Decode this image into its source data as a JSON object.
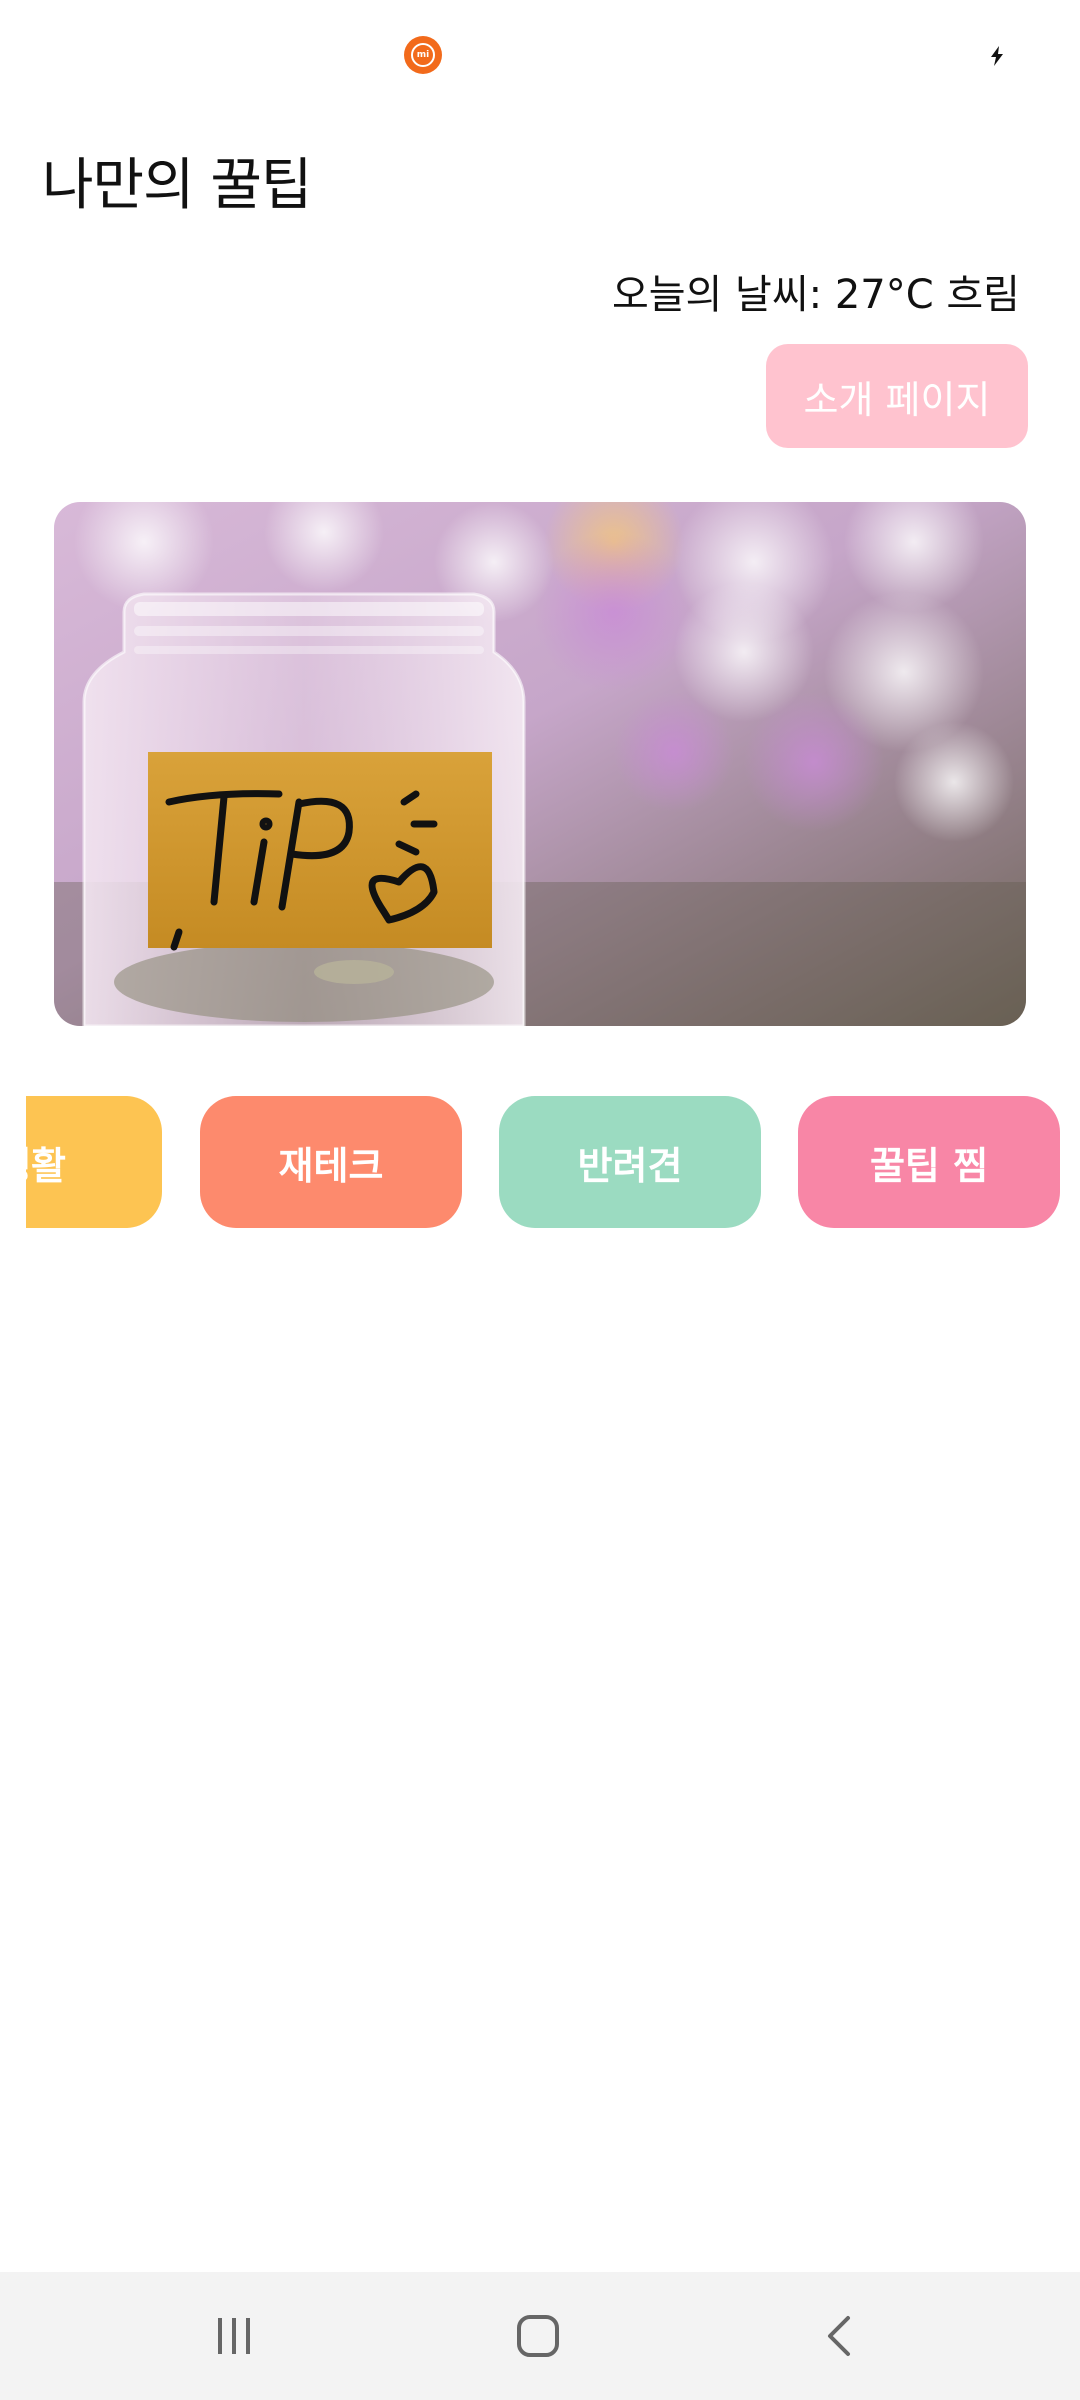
{
  "app": {
    "title": "나만의 꿀팁"
  },
  "status_bar": {
    "app_icon": "mi-app-icon",
    "app_icon_text": "mi",
    "right_icon": "charging-bolt-icon"
  },
  "weather": {
    "text": "오늘의 날씨: 27°C 흐림"
  },
  "intro_button": {
    "label": "소개 페이지",
    "color": "#ffc3cf"
  },
  "hero": {
    "label_text": "TiP",
    "icon": "tip-jar-image"
  },
  "categories": [
    {
      "label": "생활",
      "color": "#fdc452"
    },
    {
      "label": "재테크",
      "color": "#fd8a6d"
    },
    {
      "label": "반려견",
      "color": "#9bdbc1"
    },
    {
      "label": "꿀팁 찜",
      "color": "#f886a6"
    }
  ],
  "nav": {
    "recents_icon": "recent-apps-icon",
    "home_icon": "home-icon",
    "back_icon": "back-icon"
  }
}
